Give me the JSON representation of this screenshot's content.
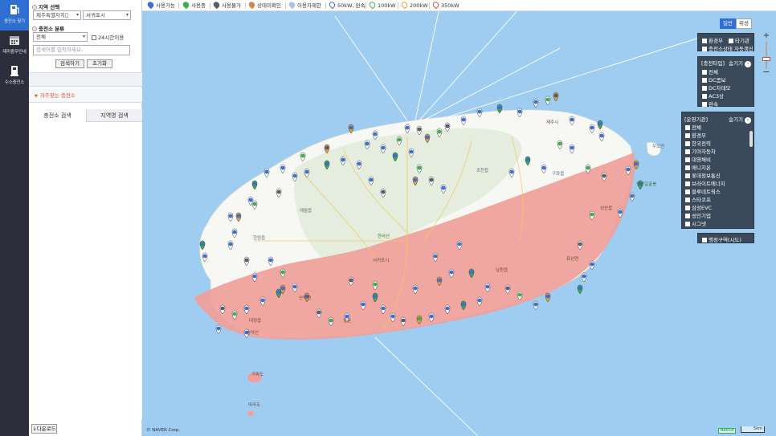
{
  "nav": {
    "items": [
      {
        "label": "충전소 찾기",
        "icon": "charger-icon",
        "active": true
      },
      {
        "label": "테마충무인네",
        "icon": "calendar-icon",
        "active": false
      },
      {
        "label": "수소충전소",
        "icon": "hydrogen-station-icon",
        "active": false
      }
    ]
  },
  "panel": {
    "region_title": "지역 선택",
    "region_province": "제주특별자치\u0000",
    "region_city": "서귀포시",
    "category_title": "충전소 분류",
    "category_value": "전체",
    "open24_label": "24시간이용",
    "search_placeholder": "검색어를 입력하세요.",
    "search_button": "검색하기",
    "reset_button": "초기화",
    "favorite_label": "자주찾는 충전소",
    "tab_station": "충전소 검색",
    "tab_region": "지역명 검색",
    "download_button": "다운로드"
  },
  "legend": {
    "items": [
      {
        "label": "사용가능",
        "color": "#3b6fd4"
      },
      {
        "label": "사용중",
        "color": "#3fae4a"
      },
      {
        "label": "사용불가",
        "color": "#555e66"
      },
      {
        "label": "상태미확인",
        "color": "#c98a54"
      },
      {
        "label": "이용자제한",
        "color": "#a9c3e8"
      },
      {
        "label": "50kW, 완속",
        "color": "#ffffff"
      },
      {
        "label": "100kW",
        "color": "#ffffff"
      },
      {
        "label": "200kW",
        "color": "#ffffff"
      },
      {
        "label": "350kW",
        "color": "#ffffff"
      }
    ]
  },
  "map": {
    "type_normal": "일반",
    "type_satellite": "위성",
    "org_box": {
      "ministry": "환경부",
      "other": "타기관",
      "auto_refresh": "충전소상태 자동갱신"
    },
    "charger_type": {
      "title": "[충전타입]",
      "hide": "숨기기",
      "items": [
        "전체",
        "DC콤보",
        "DC차데모",
        "AC3상",
        "완속"
      ]
    },
    "operator": {
      "title": "[운영기관]",
      "hide": "숨기기",
      "items": [
        "전체",
        "환경부",
        "한국전력",
        "기아자동차",
        "대영채비",
        "매니지온",
        "롯데정보통신",
        "브라이트에너지",
        "블루네트웍스",
        "스타코프",
        "삼성EVC",
        "성민기업",
        "시그넷"
      ]
    },
    "admin_area": "행정구역(시도)",
    "place_labels": [
      "제주시",
      "한라산",
      "서귀포시",
      "성산읍",
      "표선면",
      "남원읍",
      "대정읍",
      "한림읍",
      "애월읍",
      "조천읍",
      "구좌읍",
      "안덕면",
      "마라도",
      "가파도",
      "우도면",
      "성산일출봉",
      "송악산",
      "중문"
    ],
    "copyright": "© NAVER Corp.",
    "naver_badge": "NAVER",
    "scale": "5km",
    "colors": {
      "sea": "#9fcdf1",
      "land": "#f7f7f4",
      "north_zone": "#e2ecdc",
      "south_zone": "#ef9f9a",
      "accent": "#2f6fd1"
    }
  }
}
